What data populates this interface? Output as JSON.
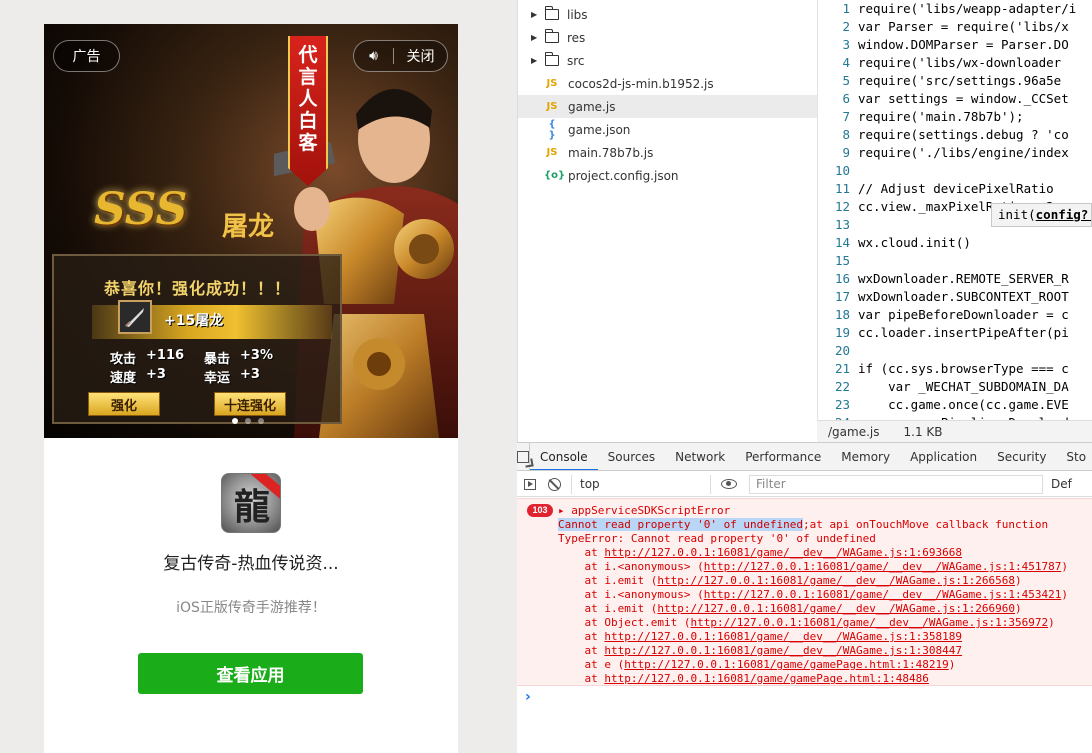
{
  "ad": {
    "tag": "广告",
    "sound_icon": "speaker-icon",
    "close_label": "关闭",
    "ribbon": "代言人白客",
    "headline": "SSS",
    "headline_suffix": "屠龙",
    "congrats": "恭喜你！强化成功！！！",
    "item_name": "+15屠龙",
    "stats": [
      {
        "label": "攻击",
        "value": "+116"
      },
      {
        "label": "暴击",
        "value": "+3%"
      },
      {
        "label": "速度",
        "value": "+3"
      },
      {
        "label": "幸运",
        "value": "+3"
      }
    ],
    "btn_enhance": "强化",
    "btn_ten": "十连强化",
    "slide_count": 3,
    "active_slide": 1,
    "app_name": "复古传奇-热血传说资...",
    "app_desc": "iOS正版传奇手游推荐！",
    "view_button": "查看应用"
  },
  "tree": [
    {
      "type": "folder",
      "name": "libs"
    },
    {
      "type": "folder",
      "name": "res"
    },
    {
      "type": "folder",
      "name": "src"
    },
    {
      "type": "js",
      "name": "cocos2d-js-min.b1952.js"
    },
    {
      "type": "js",
      "name": "game.js",
      "selected": true
    },
    {
      "type": "json",
      "name": "game.json"
    },
    {
      "type": "js",
      "name": "main.78b7b.js"
    },
    {
      "type": "cfg",
      "name": "project.config.json"
    }
  ],
  "editor": {
    "lines": [
      {
        "n": "1",
        "t": "require('libs/weapp-adapter/i"
      },
      {
        "n": "2",
        "t": "var Parser = require('libs/x"
      },
      {
        "n": "3",
        "t": "window.DOMParser = Parser.DO"
      },
      {
        "n": "4",
        "t": "require('libs/wx-downloader"
      },
      {
        "n": "5",
        "t": "require('src/settings.96a5e"
      },
      {
        "n": "6",
        "t": "var settings = window._CCSet"
      },
      {
        "n": "7",
        "t": "require('main.78b7b');"
      },
      {
        "n": "8",
        "t": "require(settings.debug ? 'co"
      },
      {
        "n": "9",
        "t": "require('./libs/engine/index"
      },
      {
        "n": "10",
        "t": ""
      },
      {
        "n": "11",
        "t": "// Adjust devicePixelRatio"
      },
      {
        "n": "12",
        "t": "cc.view._maxPixelRatio = 3;"
      },
      {
        "n": "13",
        "t": ""
      },
      {
        "n": "14",
        "t": "wx.cloud.init()"
      },
      {
        "n": "15",
        "t": ""
      },
      {
        "n": "16",
        "t": "wxDownloader.REMOTE_SERVER_R"
      },
      {
        "n": "17",
        "t": "wxDownloader.SUBCONTEXT_ROOT"
      },
      {
        "n": "18",
        "t": "var pipeBeforeDownloader = c"
      },
      {
        "n": "19",
        "t": "cc.loader.insertPipeAfter(pi"
      },
      {
        "n": "20",
        "t": ""
      },
      {
        "n": "21",
        "t": "if (cc.sys.browserType === c"
      },
      {
        "n": "22",
        "t": "    var _WECHAT_SUBDOMAIN_DA"
      },
      {
        "n": "23",
        "t": "    cc.game.once(cc.game.EVE"
      },
      {
        "n": "24",
        "t": "        cc.Pipeline.Download"
      }
    ],
    "tooltip_fn": "init(",
    "tooltip_arg": "config?:",
    "status_file": "/game.js",
    "status_size": "1.1 KB"
  },
  "devtools": {
    "tabs": [
      "Console",
      "Sources",
      "Network",
      "Performance",
      "Memory",
      "Application",
      "Security",
      "Sto"
    ],
    "active_tab": "Console",
    "context": "top",
    "filter_placeholder": "Filter",
    "levels": "Def",
    "error_count": "103",
    "error_title": "appServiceSDKScriptError",
    "error_msg_hl": "Cannot read property '0' of undefined",
    "error_msg_rest": ";at api onTouchMove callback function",
    "error_type": "TypeError: Cannot read property '0' of undefined",
    "stack": [
      {
        "pre": "    at ",
        "link": "http://127.0.0.1:16081/game/__dev__/WAGame.js:1:693668",
        "post": ""
      },
      {
        "pre": "    at i.<anonymous> (",
        "link": "http://127.0.0.1:16081/game/__dev__/WAGame.js:1:451787",
        "post": ")"
      },
      {
        "pre": "    at i.emit (",
        "link": "http://127.0.0.1:16081/game/__dev__/WAGame.js:1:266568",
        "post": ")"
      },
      {
        "pre": "    at i.<anonymous> (",
        "link": "http://127.0.0.1:16081/game/__dev__/WAGame.js:1:453421",
        "post": ")"
      },
      {
        "pre": "    at i.emit (",
        "link": "http://127.0.0.1:16081/game/__dev__/WAGame.js:1:266960",
        "post": ")"
      },
      {
        "pre": "    at Object.emit (",
        "link": "http://127.0.0.1:16081/game/__dev__/WAGame.js:1:356972",
        "post": ")"
      },
      {
        "pre": "    at ",
        "link": "http://127.0.0.1:16081/game/__dev__/WAGame.js:1:358189",
        "post": ""
      },
      {
        "pre": "    at ",
        "link": "http://127.0.0.1:16081/game/__dev__/WAGame.js:1:308447",
        "post": ""
      },
      {
        "pre": "    at e (",
        "link": "http://127.0.0.1:16081/game/gamePage.html:1:48219",
        "post": ")"
      },
      {
        "pre": "    at ",
        "link": "http://127.0.0.1:16081/game/gamePage.html:1:48486",
        "post": ""
      }
    ],
    "prompt": "›"
  }
}
